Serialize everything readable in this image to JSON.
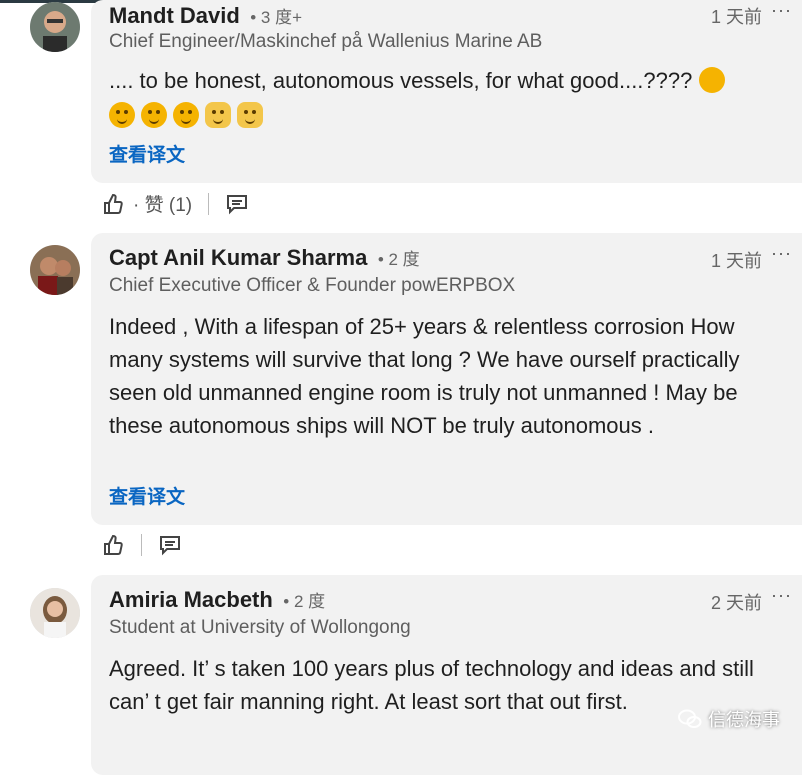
{
  "comments": [
    {
      "name": "Mandt David",
      "degree": "• 3 度+",
      "title": "Chief Engineer/Maskinchef på Wallenius Marine AB",
      "time": "1 天前",
      "more": "···",
      "text": ".... to be honest, autonomous vessels, for what good....????",
      "emojis": [
        "thinking-face-icon",
        "thinking-face-icon",
        "smiling-face-icon",
        "smiling-face-icon",
        "shrug-icon",
        "shrug-icon"
      ],
      "translate": "查看译文",
      "like_label": "· 赞 (1)"
    },
    {
      "name": "Capt Anil Kumar Sharma",
      "degree": "• 2 度",
      "title": "Chief Executive Officer & Founder powERPBOX",
      "time": "1 天前",
      "more": "···",
      "text": "Indeed , With a lifespan of 25+ years & relentless corrosion How many systems will survive that long ? We have ourself practically seen old unmanned engine room is truly not unmanned ! May be these autonomous ships will NOT be truly autonomous .",
      "translate": "查看译文"
    },
    {
      "name": "Amiria Macbeth",
      "degree": "• 2 度",
      "title": "Student at University of Wollongong",
      "time": "2 天前",
      "more": "···",
      "text": "Agreed. It’ s taken 100 years plus of technology  and ideas and still can’ t get fair manning right. At least sort that out first."
    }
  ],
  "watermark": "信德海事"
}
